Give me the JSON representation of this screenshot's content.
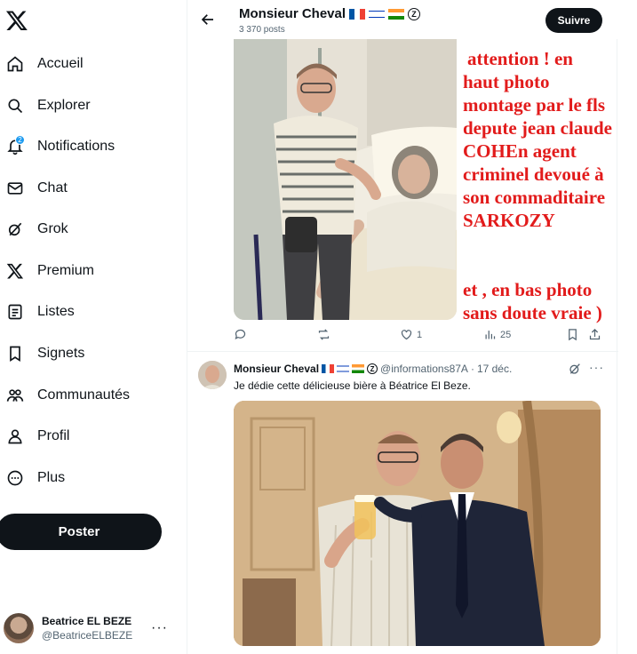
{
  "sidebar": {
    "logo": "x-logo-icon",
    "items": [
      {
        "label": "Accueil",
        "icon": "home-icon"
      },
      {
        "label": "Explorer",
        "icon": "search-icon"
      },
      {
        "label": "Notifications",
        "icon": "bell-icon",
        "badge": "2"
      },
      {
        "label": "Chat",
        "icon": "mail-icon"
      },
      {
        "label": "Grok",
        "icon": "grok-icon"
      },
      {
        "label": "Premium",
        "icon": "x-logo-icon"
      },
      {
        "label": "Listes",
        "icon": "list-icon"
      },
      {
        "label": "Signets",
        "icon": "bookmark-icon"
      },
      {
        "label": "Communautés",
        "icon": "people-icon"
      },
      {
        "label": "Profil",
        "icon": "person-icon"
      },
      {
        "label": "Plus",
        "icon": "more-circle-icon"
      }
    ],
    "post_button": "Poster",
    "account": {
      "display_name": "Beatrice EL BEZE",
      "handle": "@BeatriceELBEZE",
      "more": "···"
    }
  },
  "header": {
    "title": "Monsieur Cheval",
    "subtitle": "3 370 posts",
    "follow_label": "Suivre"
  },
  "post1": {
    "overlay": {
      "line1": "attention !  en",
      "line2": "haut photo",
      "line3": "montage par le fls",
      "line4": "depute jean claude",
      "line5": "COHEn agent",
      "line6": "criminel devoué à",
      "line7": "son commaditaire",
      "line8": "SARKOZY",
      "line9": "et , en bas photo",
      "line10": "sans doute vraie  )"
    },
    "likes": "1",
    "views": "25"
  },
  "post2": {
    "display_name": "Monsieur Cheval",
    "handle": "@informations87A",
    "separator": "·",
    "date": "17 déc.",
    "text": "Je dédie cette délicieuse bière à Béatrice El Beze.",
    "more": "···"
  },
  "colors": {
    "accent": "#1d9bf0",
    "text": "#0f1419",
    "secondary": "#536471",
    "overlay_red": "#e21b1b"
  }
}
